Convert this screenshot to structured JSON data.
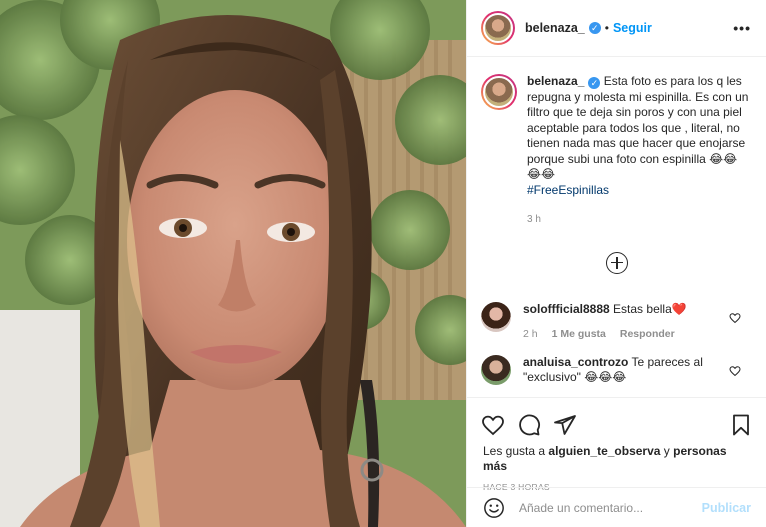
{
  "post": {
    "username": "belenaza_",
    "verified": true,
    "separator": "•",
    "follow_label": "Seguir",
    "more_icon": "more-options-icon",
    "more_label": "•••"
  },
  "caption": {
    "username": "belenaza_",
    "text": "Esta foto es para los q les repugna y molesta mi espinilla. Es con un filtro que te deja sin poros y con una piel aceptable para todos los que , literal, no tienen nada mas que hacer que enojarse porque subi una foto con espinilla 😂😂😂😂",
    "hashtag": "#FreeEspinillas",
    "time": "3 h"
  },
  "comments": [
    {
      "username": "soloffficial8888",
      "text": "Estas bella",
      "emoji": "❤️",
      "time": "2 h",
      "likes": "1 Me gusta",
      "reply": "Responder"
    },
    {
      "username": "analuisa_controzo",
      "text": "Te pareces al \"exclusivo\" 😂😂😂",
      "time": "",
      "likes": "",
      "reply": ""
    }
  ],
  "likes_line": {
    "prefix": "Les gusta a",
    "user": "alguien_te_observa",
    "connector": "y",
    "others": "personas más"
  },
  "posted_ago": "HACE 3 HORAS",
  "add_comment": {
    "placeholder": "Añade un comentario...",
    "publish_label": "Publicar"
  },
  "colors": {
    "accent": "#0095f6",
    "publish_disabled": "#b2dffc",
    "muted": "#8e8e8e",
    "hashtag": "#00376b"
  }
}
